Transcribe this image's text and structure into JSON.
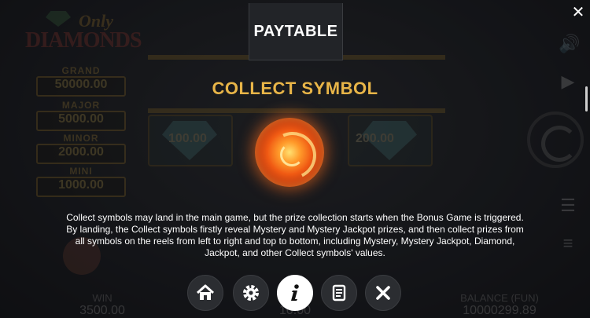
{
  "game": {
    "logo_line1": "Only",
    "logo_line2": "DIAMONDS"
  },
  "jackpots": [
    {
      "name": "GRAND",
      "value": "50000.00"
    },
    {
      "name": "MAJOR",
      "value": "5000.00"
    },
    {
      "name": "MINOR",
      "value": "2000.00"
    },
    {
      "name": "MINI",
      "value": "1000.00"
    }
  ],
  "reels": {
    "left_value": "100.00",
    "right_value": "200.00"
  },
  "footer": {
    "win_label": "WIN",
    "win_value": "3500.00",
    "bet_value": "10.00",
    "balance_label": "BALANCE (FUN)",
    "balance_value": "10000299.89"
  },
  "paytable": {
    "title": "PAYTABLE",
    "subtitle": "COLLECT SYMBOL",
    "description": "Collect symbols may land in the main game, but the prize collection starts when the Bonus Game is triggered. By landing, the Collect symbols firstly reveal Mystery and Mystery Jackpot prizes, and then collect prizes from all symbols on the reels from left to right and top to bottom, including Mystery, Mystery Jackpot, Diamond, Jackpot, and other Collect symbols' values."
  },
  "nav": [
    {
      "icon": "home-icon",
      "active": false
    },
    {
      "icon": "gear-icon",
      "active": false
    },
    {
      "icon": "info-icon",
      "active": true
    },
    {
      "icon": "scroll-icon",
      "active": false
    },
    {
      "icon": "close-icon",
      "active": false
    }
  ],
  "colors": {
    "accent_gold": "#e8b548",
    "panel": "#222428",
    "orb": "#f05a14"
  }
}
